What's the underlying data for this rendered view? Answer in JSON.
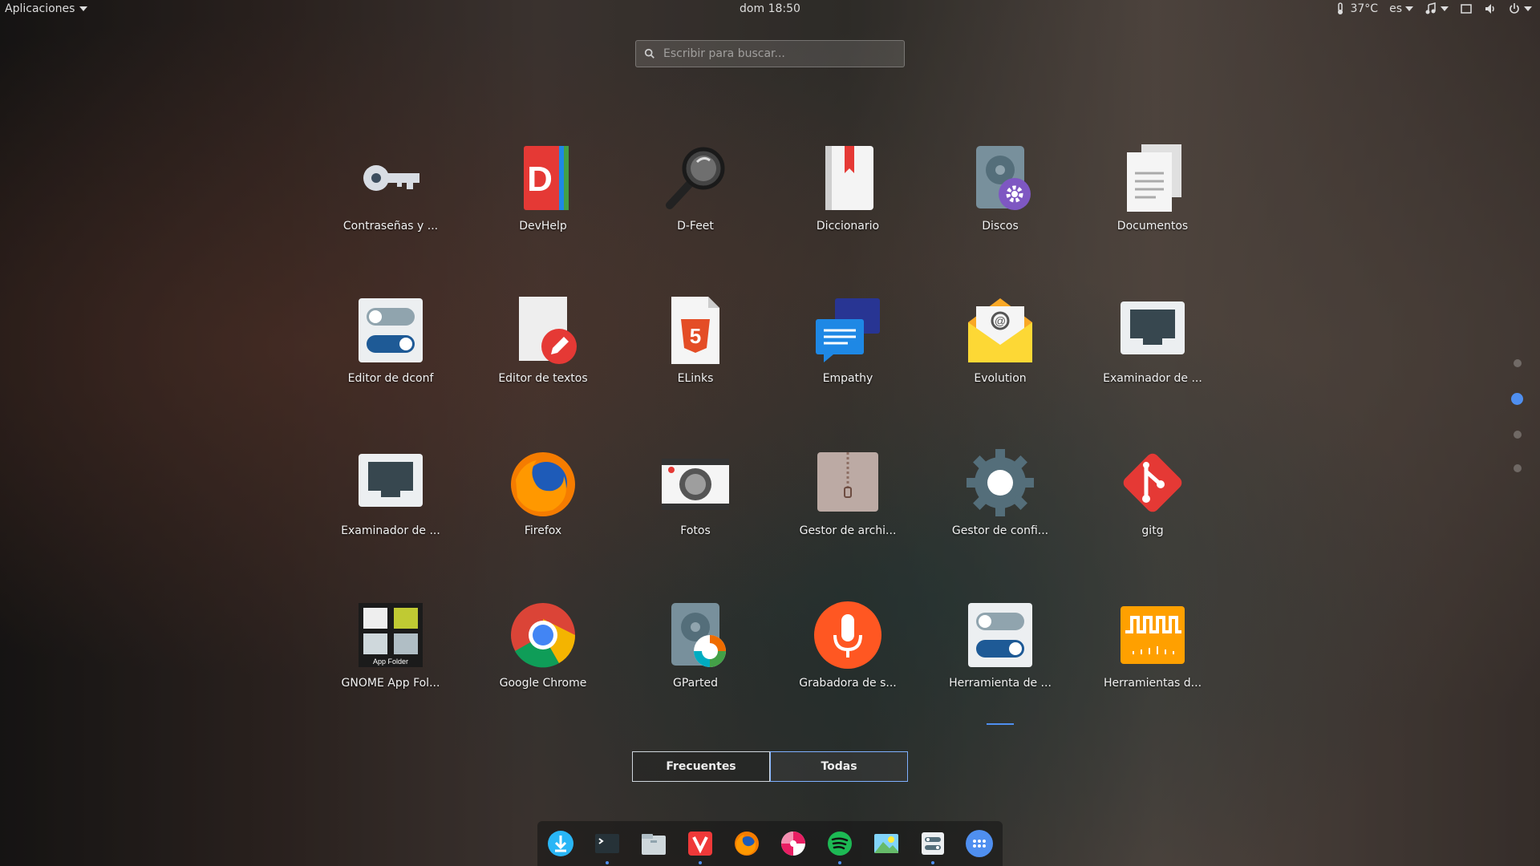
{
  "topbar": {
    "activities": "Aplicaciones",
    "clock": "dom 18:50",
    "temperature": "37°C",
    "language": "es"
  },
  "search": {
    "placeholder": "Escribir para buscar..."
  },
  "apps": [
    {
      "label": "Contraseñas y ...",
      "icon": "key-icon"
    },
    {
      "label": "DevHelp",
      "icon": "devhelp-icon"
    },
    {
      "label": "D-Feet",
      "icon": "magnifier-icon"
    },
    {
      "label": "Diccionario",
      "icon": "dictionary-icon"
    },
    {
      "label": "Discos",
      "icon": "disks-icon"
    },
    {
      "label": "Documentos",
      "icon": "documents-icon"
    },
    {
      "label": "Editor de dconf",
      "icon": "toggle-settings-icon"
    },
    {
      "label": "Editor de textos",
      "icon": "text-editor-icon"
    },
    {
      "label": "ELinks",
      "icon": "html5-icon"
    },
    {
      "label": "Empathy",
      "icon": "chat-icon"
    },
    {
      "label": "Evolution",
      "icon": "mail-icon"
    },
    {
      "label": "Examinador de ...",
      "icon": "network-icon"
    },
    {
      "label": "Examinador de ...",
      "icon": "network-icon"
    },
    {
      "label": "Firefox",
      "icon": "firefox-icon"
    },
    {
      "label": "Fotos",
      "icon": "camera-icon"
    },
    {
      "label": "Gestor de archi...",
      "icon": "archive-icon"
    },
    {
      "label": "Gestor de confi...",
      "icon": "gear-icon"
    },
    {
      "label": "gitg",
      "icon": "git-icon"
    },
    {
      "label": "GNOME App Fol...",
      "icon": "app-folder-icon",
      "caption": "App Folder"
    },
    {
      "label": "Google Chrome",
      "icon": "chrome-icon"
    },
    {
      "label": "GParted",
      "icon": "gparted-icon"
    },
    {
      "label": "Grabadora de s...",
      "icon": "microphone-icon"
    },
    {
      "label": "Herramienta de ...",
      "icon": "toggle-settings-icon",
      "running": true
    },
    {
      "label": "Herramientas d...",
      "icon": "waveform-icon"
    }
  ],
  "view_switch": {
    "frequent": "Frecuentes",
    "all": "Todas"
  },
  "dock": [
    {
      "name": "download-icon",
      "running": false
    },
    {
      "name": "terminal-icon",
      "running": true
    },
    {
      "name": "files-icon",
      "running": false
    },
    {
      "name": "vivaldi-icon",
      "running": true
    },
    {
      "name": "firefox-icon",
      "running": false
    },
    {
      "name": "lollypop-icon",
      "running": false
    },
    {
      "name": "spotify-icon",
      "running": true
    },
    {
      "name": "image-viewer-icon",
      "running": false
    },
    {
      "name": "system-settings-icon",
      "running": true
    },
    {
      "name": "show-apps-icon",
      "running": false
    }
  ],
  "colors": {
    "accent": "#4f8ff0"
  }
}
